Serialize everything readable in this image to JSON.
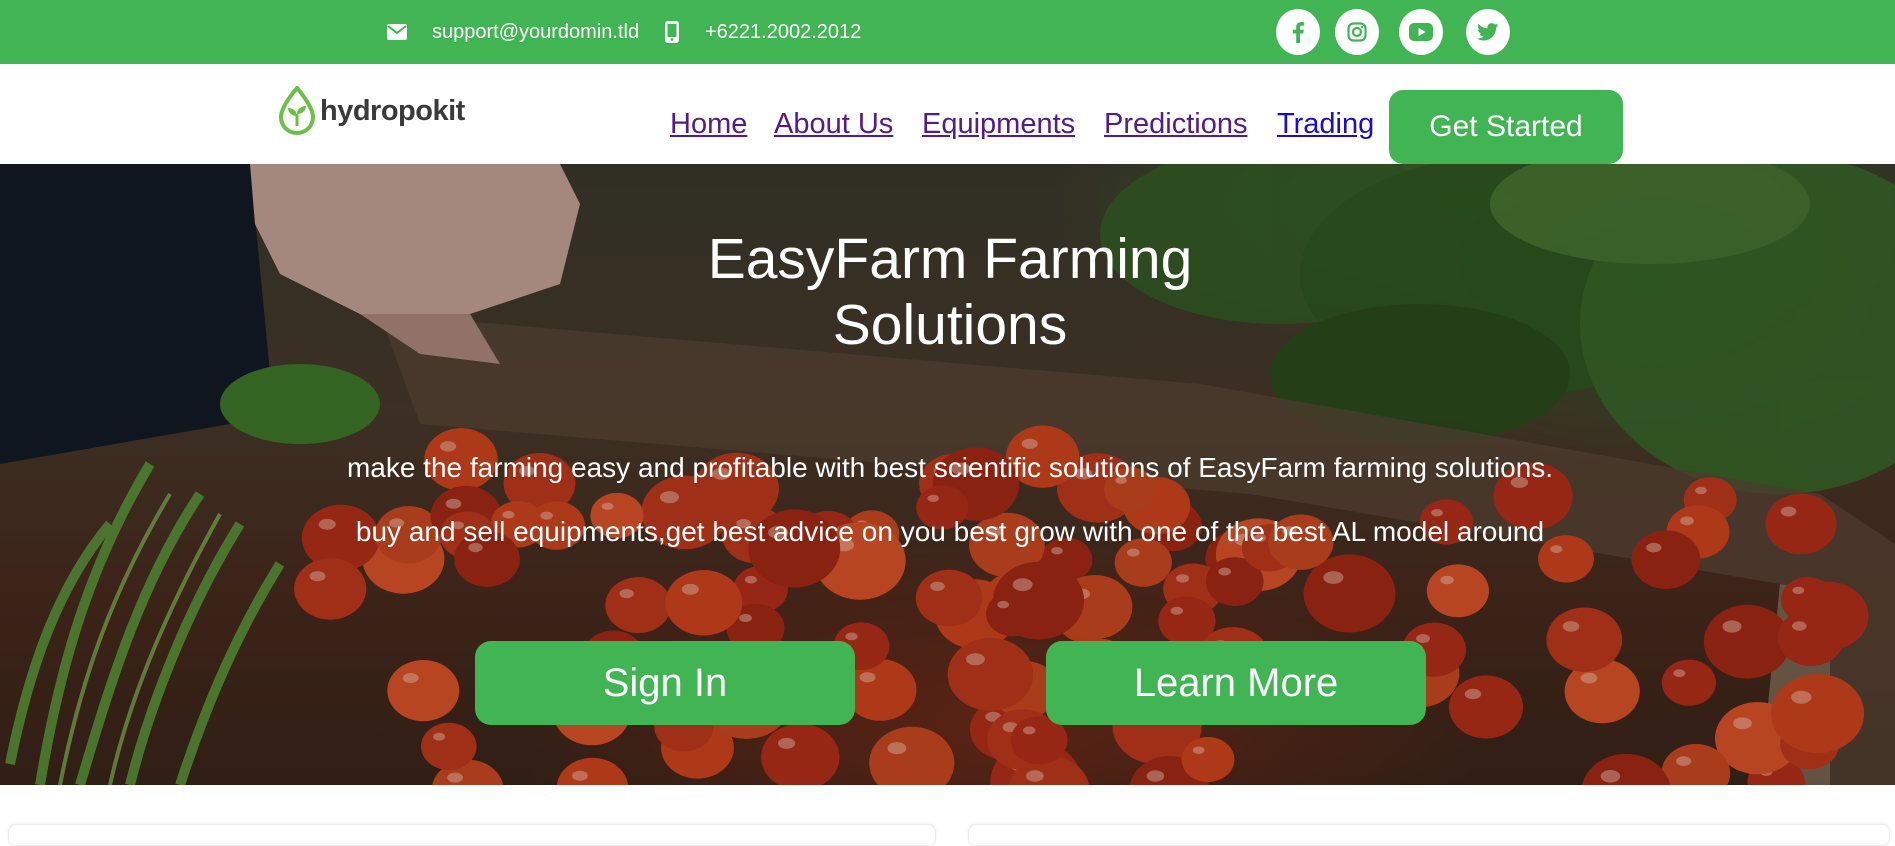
{
  "topbar": {
    "email": "support@yourdomin.tld",
    "phone": "+6221.2002.2012",
    "icons": [
      "envelope-icon",
      "mobile-phone-icon"
    ],
    "social": [
      "facebook-icon",
      "instagram-icon",
      "youtube-icon",
      "twitter-icon"
    ]
  },
  "nav": {
    "logo_text": "hydropokit",
    "links": [
      {
        "label": "Home"
      },
      {
        "label": "About Us"
      },
      {
        "label": "Equipments"
      },
      {
        "label": "Predictions"
      },
      {
        "label": "Trading"
      }
    ],
    "cta": "Get Started"
  },
  "hero": {
    "title_line1": "EasyFarm Farming",
    "title_line2": "Solutions",
    "text_line1": "make the farming easy and profitable with best scientific solutions of EasyFarm farming solutions.",
    "text_line2": "buy and sell equipments,get best advice on you best grow with one of the best AL model around",
    "signin": "Sign In",
    "learn_more": "Learn More"
  },
  "colors": {
    "brand_green": "#41b554",
    "visited_link": "#551a8b",
    "active_link": "#1a0dcc",
    "white": "#ffffff"
  }
}
